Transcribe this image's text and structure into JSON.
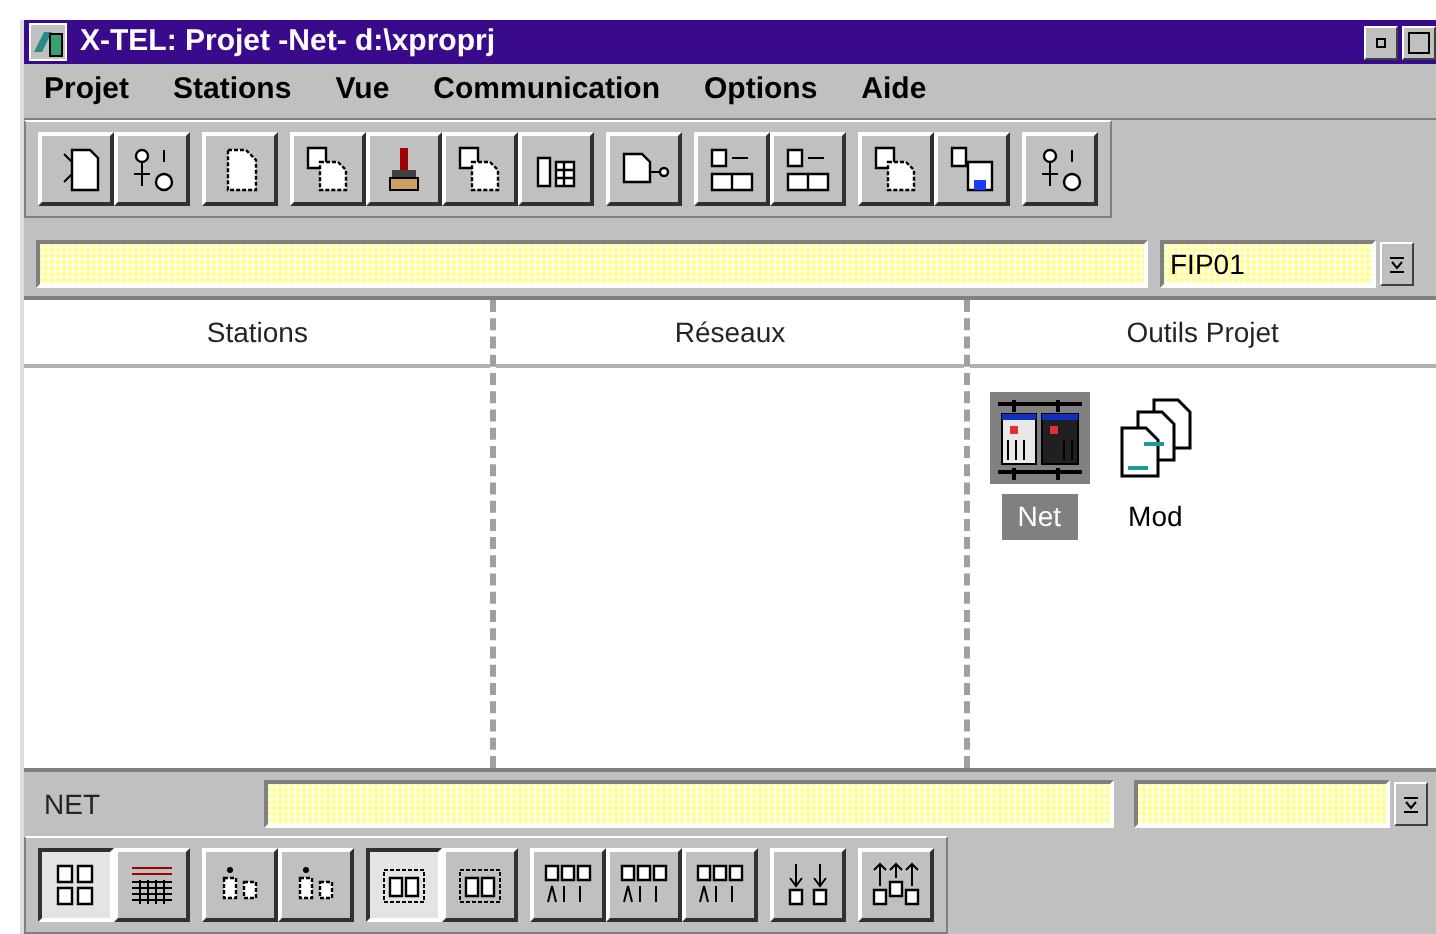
{
  "window": {
    "title": "X-TEL: Projet -Net- d:\\xproprj"
  },
  "menu": [
    {
      "label": "Projet"
    },
    {
      "label": "Stations"
    },
    {
      "label": "Vue"
    },
    {
      "label": "Communication"
    },
    {
      "label": "Options"
    },
    {
      "label": "Aide"
    }
  ],
  "top_toolbar": [
    {
      "buttons": [
        {
          "kind": "cut"
        },
        {
          "kind": "nodes"
        }
      ]
    },
    {
      "buttons": [
        {
          "kind": "doc"
        }
      ]
    },
    {
      "buttons": [
        {
          "kind": "docs"
        },
        {
          "kind": "brush"
        },
        {
          "kind": "docs"
        },
        {
          "kind": "grid"
        }
      ]
    },
    {
      "buttons": [
        {
          "kind": "link"
        }
      ]
    },
    {
      "buttons": [
        {
          "kind": "swap"
        },
        {
          "kind": "swap"
        }
      ]
    },
    {
      "buttons": [
        {
          "kind": "docs"
        },
        {
          "kind": "floppy"
        }
      ]
    },
    {
      "buttons": [
        {
          "kind": "nodes"
        }
      ]
    }
  ],
  "station_combo": {
    "value": "FIP01"
  },
  "columns": [
    {
      "header": "Stations"
    },
    {
      "header": "Réseaux"
    },
    {
      "header": "Outils Projet"
    }
  ],
  "tools": [
    {
      "label": "Net",
      "kind": "network",
      "selected": true
    },
    {
      "label": "Mod",
      "kind": "modules",
      "selected": false
    }
  ],
  "status": {
    "label": "NET"
  },
  "bottom_toolbar": [
    {
      "buttons": [
        {
          "kind": "docs4",
          "pressed": true
        },
        {
          "kind": "list",
          "pressed": false
        }
      ]
    },
    {
      "buttons": [
        {
          "kind": "doc2",
          "pressed": false
        },
        {
          "kind": "doc2",
          "pressed": false
        }
      ]
    },
    {
      "buttons": [
        {
          "kind": "docs2",
          "pressed": true
        },
        {
          "kind": "docs2",
          "pressed": false
        }
      ]
    },
    {
      "buttons": [
        {
          "kind": "docs3",
          "pressed": false
        },
        {
          "kind": "docs3",
          "pressed": false
        },
        {
          "kind": "docs3",
          "pressed": false
        }
      ]
    },
    {
      "buttons": [
        {
          "kind": "down",
          "pressed": false
        }
      ]
    },
    {
      "buttons": [
        {
          "kind": "up",
          "pressed": false
        }
      ]
    }
  ]
}
